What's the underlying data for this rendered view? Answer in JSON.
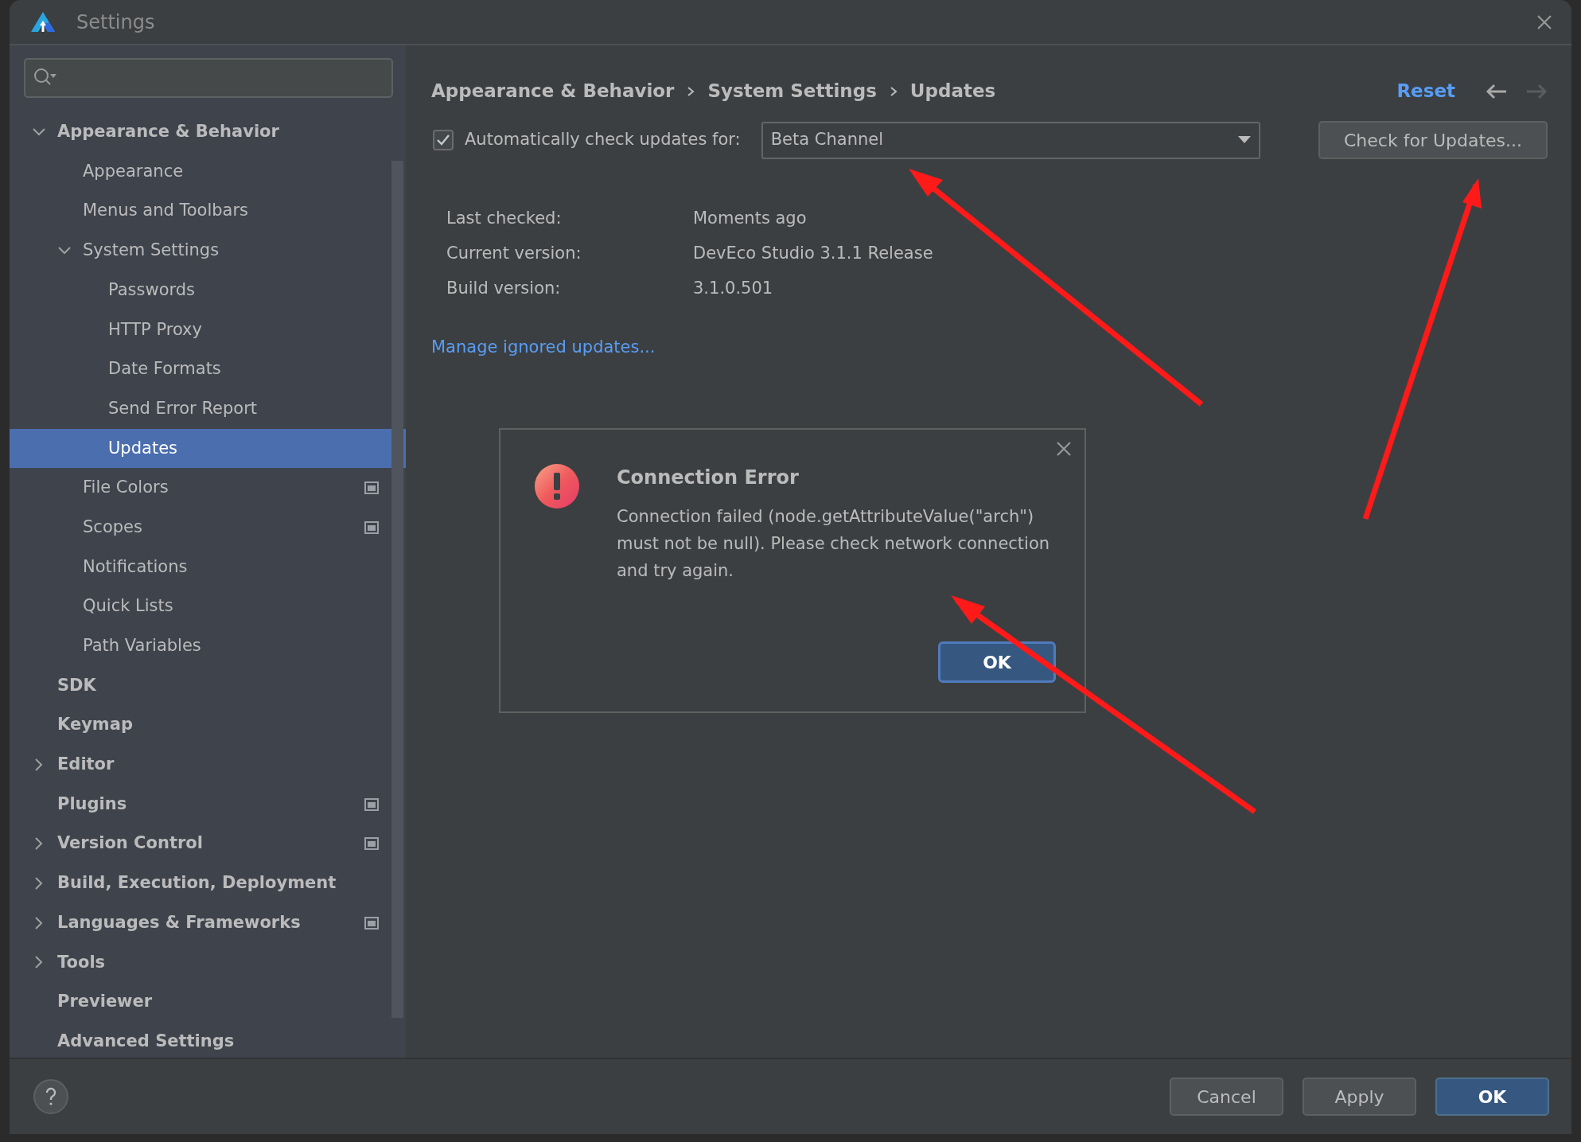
{
  "window": {
    "title": "Settings"
  },
  "sidebar": {
    "items": [
      {
        "label": "Appearance & Behavior",
        "expanded": true,
        "selected": false,
        "project_badge": false,
        "children": [
          {
            "label": "Appearance",
            "selected": false,
            "project_badge": false
          },
          {
            "label": "Menus and Toolbars",
            "selected": false,
            "project_badge": false
          },
          {
            "label": "System Settings",
            "expanded": true,
            "selected": false,
            "project_badge": false,
            "children": [
              {
                "label": "Passwords",
                "selected": false,
                "project_badge": false
              },
              {
                "label": "HTTP Proxy",
                "selected": false,
                "project_badge": false
              },
              {
                "label": "Date Formats",
                "selected": false,
                "project_badge": false
              },
              {
                "label": "Send Error Report",
                "selected": false,
                "project_badge": false
              },
              {
                "label": "Updates",
                "selected": true,
                "project_badge": false
              }
            ]
          },
          {
            "label": "File Colors",
            "selected": false,
            "project_badge": true
          },
          {
            "label": "Scopes",
            "selected": false,
            "project_badge": true
          },
          {
            "label": "Notifications",
            "selected": false,
            "project_badge": false
          },
          {
            "label": "Quick Lists",
            "selected": false,
            "project_badge": false
          },
          {
            "label": "Path Variables",
            "selected": false,
            "project_badge": false
          }
        ]
      },
      {
        "label": "SDK",
        "selected": false,
        "project_badge": false
      },
      {
        "label": "Keymap",
        "selected": false,
        "project_badge": false
      },
      {
        "label": "Editor",
        "expanded": false,
        "selected": false,
        "project_badge": false
      },
      {
        "label": "Plugins",
        "selected": false,
        "project_badge": true
      },
      {
        "label": "Version Control",
        "expanded": false,
        "selected": false,
        "project_badge": true
      },
      {
        "label": "Build, Execution, Deployment",
        "expanded": false,
        "selected": false,
        "project_badge": false
      },
      {
        "label": "Languages & Frameworks",
        "expanded": false,
        "selected": false,
        "project_badge": true
      },
      {
        "label": "Tools",
        "expanded": false,
        "selected": false,
        "project_badge": false
      },
      {
        "label": "Previewer",
        "selected": false,
        "project_badge": false
      },
      {
        "label": "Advanced Settings",
        "selected": false,
        "project_badge": false
      }
    ]
  },
  "breadcrumb": [
    "Appearance & Behavior",
    "System Settings",
    "Updates"
  ],
  "header": {
    "reset": "Reset",
    "back_disabled": false,
    "forward_disabled": true
  },
  "auto_check": {
    "checked": true,
    "label": "Automatically check updates for:",
    "channel": "Beta Channel",
    "button": "Check for Updates..."
  },
  "info": [
    {
      "label": "Last checked:",
      "value": "Moments ago"
    },
    {
      "label": "Current version:",
      "value": "DevEco Studio 3.1.1 Release"
    },
    {
      "label": "Build version:",
      "value": "3.1.0.501"
    }
  ],
  "manage_link": "Manage ignored updates...",
  "dialog": {
    "title": "Connection Error",
    "message": "Connection failed (node.getAttributeValue(\"arch\") must not be null). Please check network connection and try again.",
    "button": "OK"
  },
  "footer": {
    "buttons": [
      {
        "label": "Cancel",
        "default": false
      },
      {
        "label": "Apply",
        "default": false
      },
      {
        "label": "OK",
        "default": true
      }
    ]
  }
}
